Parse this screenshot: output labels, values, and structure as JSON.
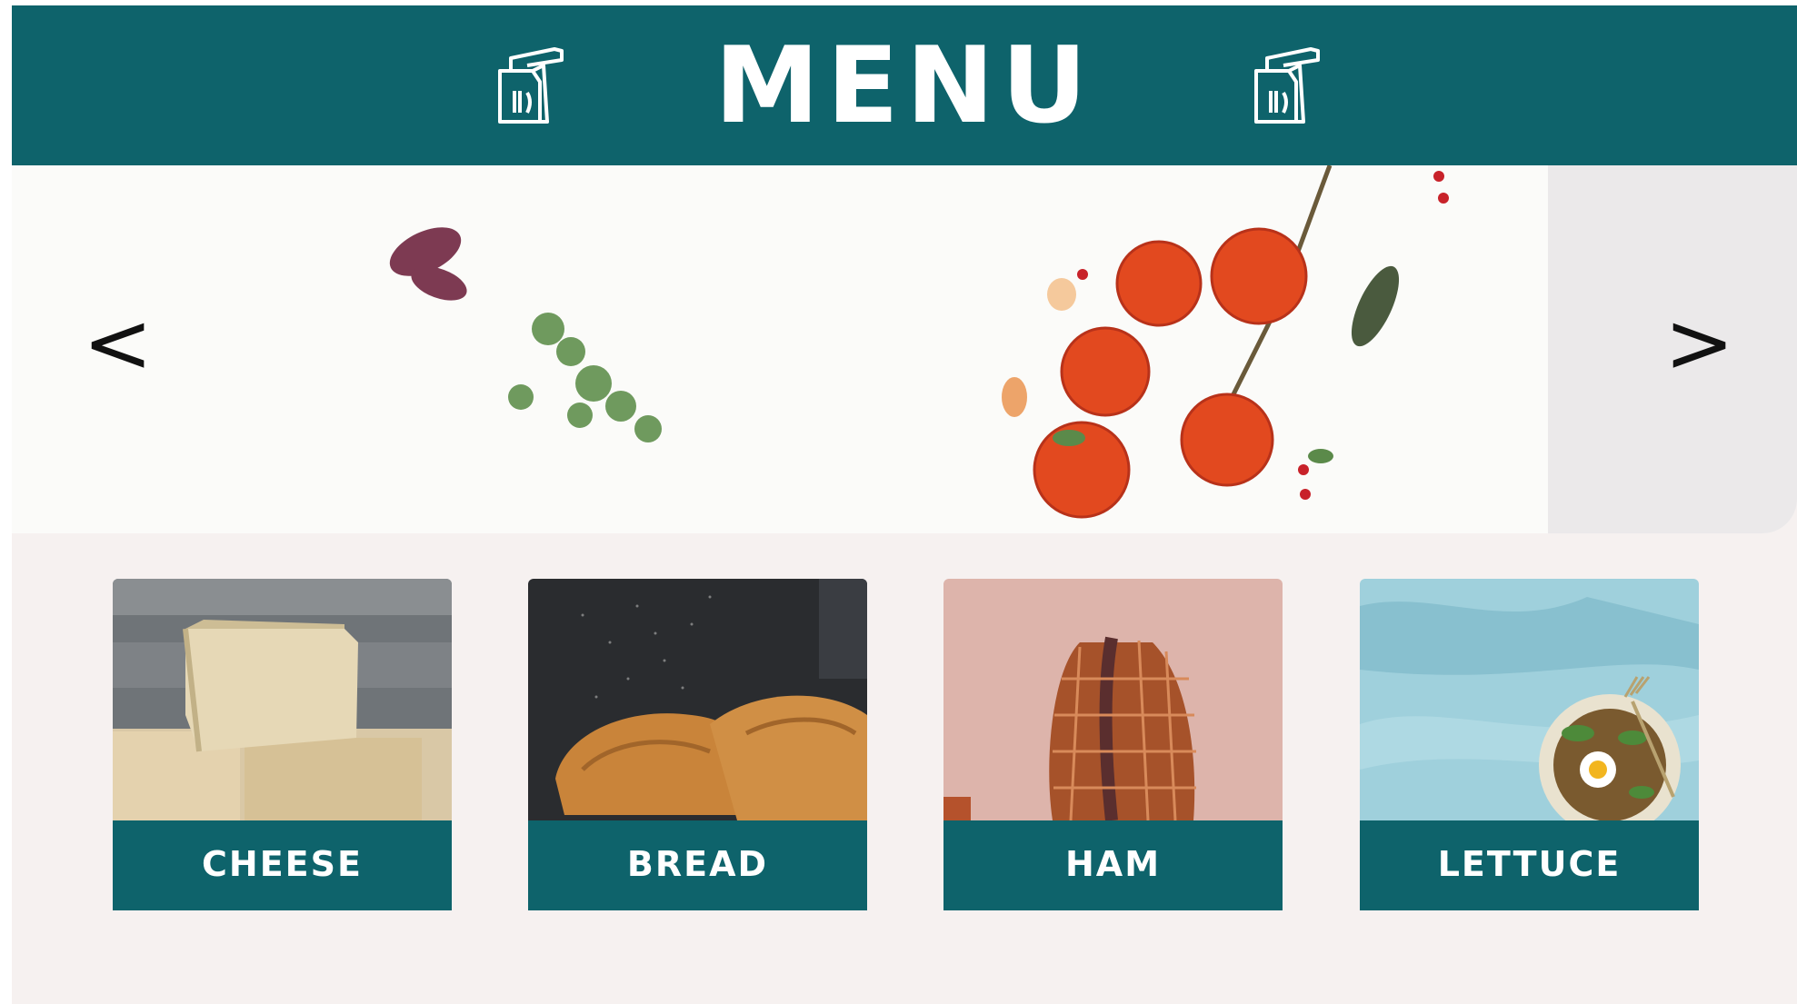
{
  "header": {
    "title": "MENU",
    "left_icon": "takeaway-bag-icon",
    "right_icon": "takeaway-bag-icon"
  },
  "carousel": {
    "prev_label": "<",
    "next_label": ">"
  },
  "categories": [
    {
      "label": "CHEESE",
      "image": "cheese-wheels-photo"
    },
    {
      "label": "BREAD",
      "image": "croissants-photo"
    },
    {
      "label": "HAM",
      "image": "sliced-ham-photo"
    },
    {
      "label": "LETTUCE",
      "image": "salad-plate-photo"
    }
  ],
  "colors": {
    "brand_teal": "#0e636b",
    "background": "#f6f1f0",
    "label_text": "#ffffff"
  }
}
